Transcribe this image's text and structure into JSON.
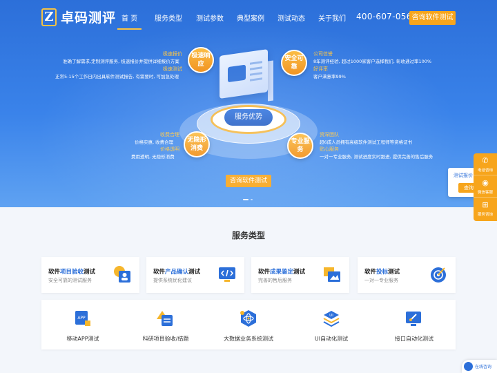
{
  "brand": {
    "name": "卓码测评",
    "mark": "Z"
  },
  "nav": {
    "items": [
      "首 页",
      "服务类型",
      "测试参数",
      "典型案例",
      "测试动态",
      "关于我们"
    ],
    "phone": "400-607-0568",
    "cta": "咨询软件测试"
  },
  "hero": {
    "center_label": "服务优势",
    "features": [
      {
        "bubble": "极速响应",
        "title1": "极速报价",
        "desc1": "准确了解需求,定制测评服务, 极速报价并提供详细报价方案",
        "title2": "极速测试",
        "desc2": "正常5-15个工作日内出具软件测试报告, 有需要时, 可加急处理"
      },
      {
        "bubble": "安全可靠",
        "title1": "公司信誉",
        "desc1": "8年测评经验, 超过1000家客户选择我们, 彰收通过率100%",
        "title2": "好评率",
        "desc2": "客户满意率99%"
      },
      {
        "bubble": "无隐形消费",
        "title1": "收费合理",
        "desc1": "价格实惠, 收费合理",
        "title2": "价格透明",
        "desc2": "费用透明, 无隐形消费"
      },
      {
        "bubble": "专业服务",
        "title1": "资深团队",
        "desc1": "超6成人员拥有高级软件测试工程师等资格证书",
        "title2": "贴心服务",
        "desc2": "一对一专业服务, 测试进度实时跟进, 提供完善的售后服务"
      }
    ],
    "cta": "咨询软件测试"
  },
  "side": {
    "popup_title": "测试报价",
    "popup_button": "查询",
    "items": [
      {
        "icon": "phone-icon",
        "label": "电话咨询"
      },
      {
        "icon": "wechat-icon",
        "label": "微信客服"
      },
      {
        "icon": "plus-icon",
        "label": "服务咨询"
      }
    ]
  },
  "services": {
    "title": "服务类型",
    "cards": [
      {
        "pre": "软件",
        "hl": "项目验收",
        "post": "测试",
        "sub": "安全可靠的测试服务"
      },
      {
        "pre": "软件",
        "hl": "产品确认",
        "post": "测试",
        "sub": "提供系统优化建议"
      },
      {
        "pre": "软件",
        "hl": "成果鉴定",
        "post": "测试",
        "sub": "完善的售后服务"
      },
      {
        "pre": "软件",
        "hl": "投标",
        "post": "测试",
        "sub": "一对一专业服务"
      }
    ],
    "items": [
      {
        "label": "移动APP测试",
        "icon_text": "APP"
      },
      {
        "label": "科研项目验收/结题",
        "icon_text": ""
      },
      {
        "label": "大数据业务系统测试",
        "icon_text": ""
      },
      {
        "label": "UI自动化测试",
        "icon_text": "UI"
      },
      {
        "label": "接口自动化测试",
        "icon_text": ""
      }
    ]
  },
  "chat": {
    "label": "在线咨询"
  },
  "colors": {
    "primary": "#2c6fd9",
    "accent": "#f7a51c"
  }
}
